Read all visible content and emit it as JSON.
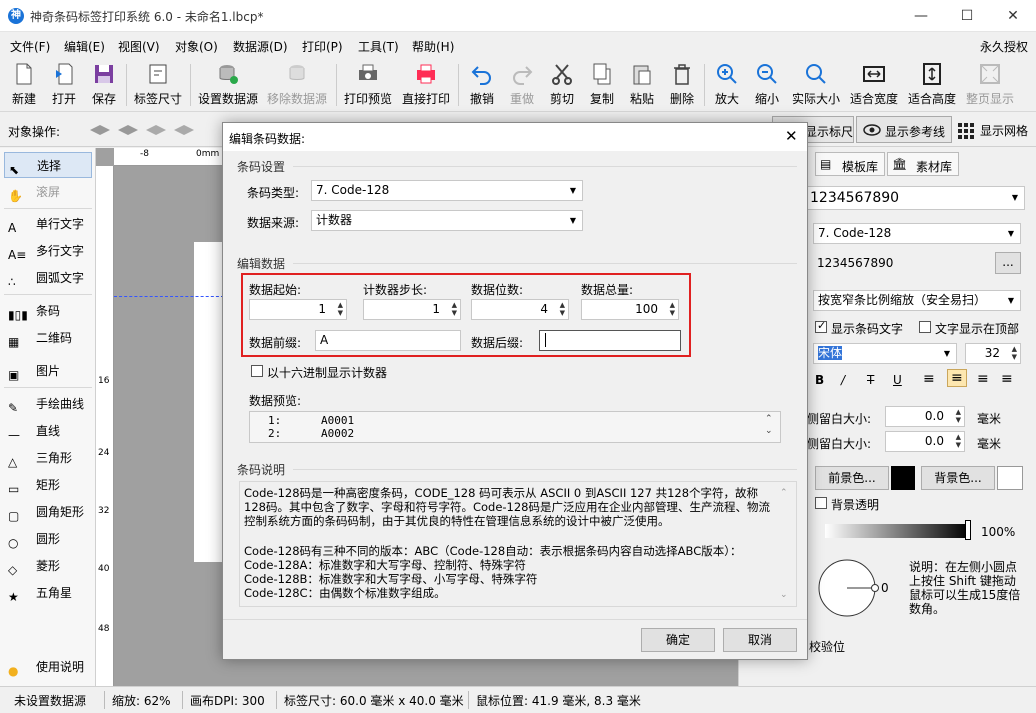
{
  "window": {
    "title": "神奇条码标签打印系统 6.0 - 未命名1.lbcp*",
    "minimize": "—",
    "maximize": "☐",
    "close": "✕"
  },
  "menu": {
    "items": [
      "文件(F)",
      "编辑(E)",
      "视图(V)",
      "对象(O)",
      "数据源(D)",
      "打印(P)",
      "工具(T)",
      "帮助(H)"
    ],
    "license": "永久授权"
  },
  "toolbar": {
    "items": [
      "新建",
      "打开",
      "保存",
      "标签尺寸",
      "设置数据源",
      "移除数据源",
      "打印预览",
      "直接打印",
      "撤销",
      "重做",
      "剪切",
      "复制",
      "粘贴",
      "删除",
      "放大",
      "缩小",
      "实际大小",
      "适合宽度",
      "适合高度",
      "整页显示"
    ]
  },
  "objbar": {
    "label": "对象操作:",
    "show_ruler": "显示标尺",
    "show_guides": "显示参考线",
    "show_grid": "显示网格"
  },
  "left": {
    "items": [
      "选择",
      "滚屏",
      "单行文字",
      "多行文字",
      "圆弧文字",
      "条码",
      "二维码",
      "图片",
      "手绘曲线",
      "直线",
      "三角形",
      "矩形",
      "圆角矩形",
      "圆形",
      "菱形",
      "五角星",
      "使用说明"
    ]
  },
  "ruler": {
    "top": [
      "-8",
      "0mm"
    ],
    "left": [
      "16",
      "24",
      "32",
      "40",
      "48"
    ]
  },
  "right": {
    "tab_templates": "模板库",
    "tab_assets": "素材库",
    "data_value": "1234567890",
    "barcode_type": "7. Code-128",
    "data_text": "1234567890",
    "more": "...",
    "scaling": "按宽窄条比例缩放（安全易扫）",
    "show_text": "显示条码文字",
    "text_top": "文字显示在顶部",
    "font": "宋体",
    "font_size": "32",
    "left_margin_label": "侧留白大小:",
    "left_margin": "0.0",
    "right_margin_label": "侧留白大小:",
    "right_margin": "0.0",
    "unit": "毫米",
    "fg_btn": "前景色...",
    "bg_btn": "背景色...",
    "transparent": "背景透明",
    "opacity": "100%",
    "rotation": "0",
    "hint": "说明：在左侧小圆点上按住 Shift 键拖动鼠标可以生成15度倍数角。",
    "verify": "校验位"
  },
  "dialog": {
    "title": "编辑条码数据:",
    "group_barcode": "条码设置",
    "barcode_type_label": "条码类型:",
    "barcode_type": "7. Code-128",
    "data_source_label": "数据来源:",
    "data_source": "计数器",
    "group_edit": "编辑数据",
    "start_label": "数据起始:",
    "start": "1",
    "step_label": "计数器步长:",
    "step": "1",
    "digits_label": "数据位数:",
    "digits": "4",
    "total_label": "数据总量:",
    "total": "100",
    "prefix_label": "数据前缀:",
    "prefix": "A",
    "suffix_label": "数据后缀:",
    "suffix": "",
    "hex_label": "以十六进制显示计数器",
    "preview_label": "数据预览:",
    "preview": [
      "1:      A0001",
      "2:      A0002"
    ],
    "group_desc": "条码说明",
    "desc_p1": "Code-128码是一种高密度条码，CODE_128 码可表示从 ASCII 0 到ASCII 127 共128个字符，故称128码。其中包含了数字、字母和符号字符。Code-128码是广泛应用在企业内部管理、生产流程、物流控制系统方面的条码码制，由于其优良的特性在管理信息系统的设计中被广泛使用。",
    "desc_p2": "Code-128码有三种不同的版本：ABC（Code-128自动：表示根据条码内容自动选择ABC版本）：",
    "desc_a": "Code-128A：标准数字和大写字母、控制符、特殊字符",
    "desc_b": "Code-128B：标准数字和大写字母、小写字母、特殊字符",
    "desc_c": "Code-128C：由偶数个标准数字组成。",
    "ok": "确定",
    "cancel": "取消"
  },
  "status": {
    "datasource": "未设置数据源",
    "zoom": "缩放: 62%",
    "dpi": "画布DPI: 300",
    "size": "标签尺寸: 60.0 毫米 x 40.0 毫米",
    "mouse": "鼠标位置: 41.9 毫米, 8.3 毫米"
  },
  "colors": {
    "accent": "#1a73d8",
    "highlight": "#e02020",
    "delete": "#ff2d55"
  }
}
